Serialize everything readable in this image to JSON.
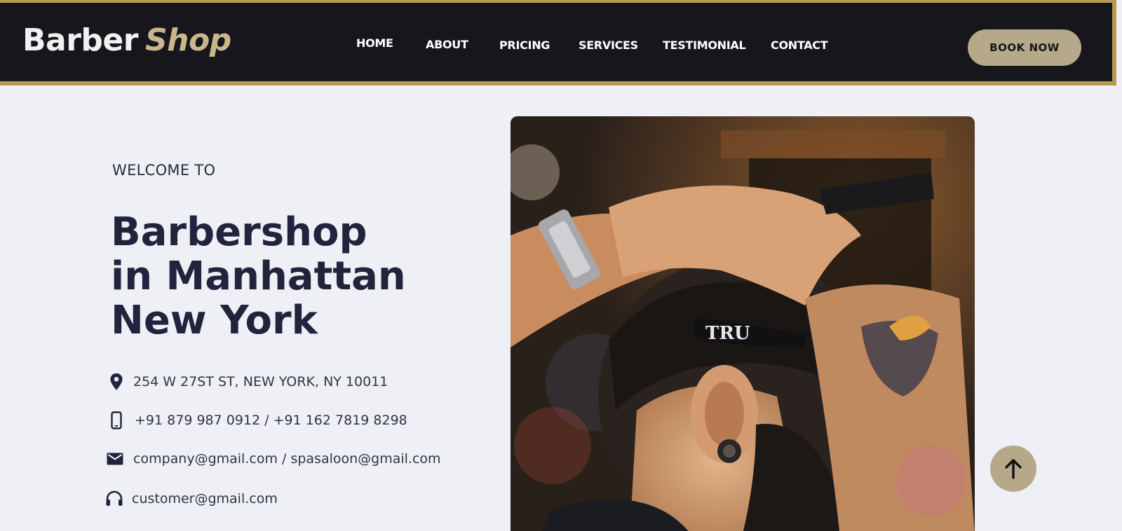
{
  "header": {
    "logo": {
      "word1": "Barber",
      "word2": "Shop"
    },
    "nav": [
      {
        "label": "HOME"
      },
      {
        "label": "ABOUT"
      },
      {
        "label": "PRICING"
      },
      {
        "label": "SERVICES"
      },
      {
        "label": "TESTIMONIAL"
      },
      {
        "label": "CONTACT"
      }
    ],
    "book_button": "BOOK NOW"
  },
  "hero": {
    "welcome": "WELCOME TO",
    "title_lines": [
      "Barbershop",
      "in Manhattan",
      "New York"
    ],
    "info": {
      "address": "254 W 27ST ST, NEW YORK, NY 10011",
      "phone": "+91 879 987 0912 / +91 162 7819 8298",
      "email": "company@gmail.com / spasaloon@gmail.com",
      "support": "customer@gmail.com"
    },
    "image": {
      "trimmer_text": "TRU"
    }
  },
  "icons": {
    "address": "location-pin-icon",
    "phone": "phone-icon",
    "email": "envelope-icon",
    "support": "headset-icon",
    "scroll_top": "arrow-up-icon"
  },
  "colors": {
    "header_bg": "#16161c",
    "accent_gold": "#b89a4e",
    "button_bg": "#b5a98a",
    "title_text": "#23233d",
    "page_bg": "#eef0f6"
  }
}
